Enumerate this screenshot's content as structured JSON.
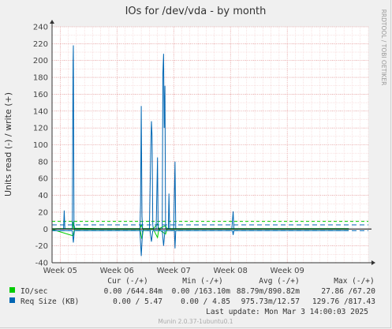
{
  "chart_data": {
    "type": "line",
    "title": "IOs for /dev/vda - by month",
    "ylabel": "Units read (-) / write (+)",
    "side_label": "RRDTOOL / TOBI OETIKER",
    "ylim": [
      -40,
      240
    ],
    "yticks": [
      -40,
      -20,
      0,
      20,
      40,
      60,
      80,
      100,
      120,
      140,
      160,
      180,
      200,
      220,
      240
    ],
    "xlim": [
      "2025-01-26",
      "2025-03-06"
    ],
    "xticks": [
      {
        "x": "2025-01-27",
        "label": "Week 05"
      },
      {
        "x": "2025-02-03",
        "label": "Week 06"
      },
      {
        "x": "2025-02-10",
        "label": "Week 07"
      },
      {
        "x": "2025-02-17",
        "label": "Week 08"
      },
      {
        "x": "2025-02-24",
        "label": "Week 09"
      }
    ],
    "grid": true,
    "series": [
      {
        "name": "IO/sec",
        "color": "#00cc00",
        "points": [
          [
            "2025-01-26T00:00",
            0.4
          ],
          [
            "2025-01-27T00:00",
            0.5
          ],
          [
            "2025-01-28T12:00",
            0.6
          ],
          [
            "2025-01-28T14:00",
            9
          ],
          [
            "2025-01-28T16:00",
            1
          ],
          [
            "2025-02-01T00:00",
            0.5
          ],
          [
            "2025-02-05T20:00",
            0.5
          ],
          [
            "2025-02-06T00:00",
            5
          ],
          [
            "2025-02-06T04:00",
            0.6
          ],
          [
            "2025-02-07T12:00",
            0.5
          ],
          [
            "2025-02-08T00:00",
            6
          ],
          [
            "2025-02-08T04:00",
            0.5
          ],
          [
            "2025-02-09T00:00",
            4
          ],
          [
            "2025-02-09T04:00",
            0.5
          ],
          [
            "2025-02-16T00:00",
            0.5
          ],
          [
            "2025-03-03T14:00",
            0.5
          ]
        ],
        "neg_points": [
          [
            "2025-01-26T00:00",
            0.3
          ],
          [
            "2025-01-28T14:00",
            8
          ],
          [
            "2025-01-28T18:00",
            0.4
          ],
          [
            "2025-02-05T20:00",
            0.4
          ],
          [
            "2025-02-06T02:00",
            12
          ],
          [
            "2025-02-06T06:00",
            0.4
          ],
          [
            "2025-02-07T12:00",
            0.4
          ],
          [
            "2025-02-08T00:00",
            10
          ],
          [
            "2025-02-08T04:00",
            0.4
          ],
          [
            "2025-02-09T00:00",
            6
          ],
          [
            "2025-02-09T04:00",
            0.4
          ],
          [
            "2025-03-03T14:00",
            0.3
          ]
        ],
        "max_line": 9
      },
      {
        "name": "Req Size (KB)",
        "color": "#0066b3",
        "points": [
          [
            "2025-01-26T00:00",
            0
          ],
          [
            "2025-01-27T10:00",
            0
          ],
          [
            "2025-01-27T12:00",
            22
          ],
          [
            "2025-01-27T14:00",
            0
          ],
          [
            "2025-01-28T12:00",
            0
          ],
          [
            "2025-01-28T14:00",
            195
          ],
          [
            "2025-01-28T15:00",
            218
          ],
          [
            "2025-01-28T17:00",
            5
          ],
          [
            "2025-01-28T20:00",
            0
          ],
          [
            "2025-02-05T20:00",
            0
          ],
          [
            "2025-02-05T22:00",
            30
          ],
          [
            "2025-02-06T00:00",
            146
          ],
          [
            "2025-02-06T02:00",
            15
          ],
          [
            "2025-02-06T04:00",
            0
          ],
          [
            "2025-02-07T00:00",
            0
          ],
          [
            "2025-02-07T04:00",
            92
          ],
          [
            "2025-02-07T06:00",
            128
          ],
          [
            "2025-02-07T08:00",
            110
          ],
          [
            "2025-02-07T10:00",
            5
          ],
          [
            "2025-02-07T12:00",
            0
          ],
          [
            "2025-02-07T20:00",
            0
          ],
          [
            "2025-02-08T00:00",
            85
          ],
          [
            "2025-02-08T02:00",
            0
          ],
          [
            "2025-02-08T14:00",
            0
          ],
          [
            "2025-02-08T16:00",
            185
          ],
          [
            "2025-02-08T18:00",
            208
          ],
          [
            "2025-02-08T20:00",
            120
          ],
          [
            "2025-02-08T22:00",
            170
          ],
          [
            "2025-02-09T00:00",
            0
          ],
          [
            "2025-02-09T08:00",
            0
          ],
          [
            "2025-02-09T10:00",
            42
          ],
          [
            "2025-02-09T12:00",
            0
          ],
          [
            "2025-02-10T00:00",
            0
          ],
          [
            "2025-02-10T04:00",
            80
          ],
          [
            "2025-02-10T06:00",
            0
          ],
          [
            "2025-02-17T04:00",
            0
          ],
          [
            "2025-02-17T08:00",
            21
          ],
          [
            "2025-02-17T10:00",
            0
          ],
          [
            "2025-03-03T14:00",
            0
          ]
        ],
        "neg_points": [
          [
            "2025-01-26T00:00",
            2
          ],
          [
            "2025-01-28T12:00",
            2
          ],
          [
            "2025-01-28T15:00",
            16
          ],
          [
            "2025-01-28T18:00",
            2
          ],
          [
            "2025-02-05T20:00",
            2
          ],
          [
            "2025-02-06T00:00",
            32
          ],
          [
            "2025-02-06T04:00",
            2
          ],
          [
            "2025-02-07T02:00",
            2
          ],
          [
            "2025-02-07T06:00",
            15
          ],
          [
            "2025-02-07T10:00",
            2
          ],
          [
            "2025-02-08T14:00",
            2
          ],
          [
            "2025-02-08T18:00",
            20
          ],
          [
            "2025-02-08T22:00",
            2
          ],
          [
            "2025-02-10T02:00",
            2
          ],
          [
            "2025-02-10T04:00",
            23
          ],
          [
            "2025-02-10T06:00",
            2
          ],
          [
            "2025-02-17T06:00",
            2
          ],
          [
            "2025-02-17T08:00",
            7
          ],
          [
            "2025-02-17T10:00",
            2
          ],
          [
            "2025-03-03T14:00",
            2
          ]
        ],
        "max_line": 5,
        "neg_max_line": 2
      }
    ]
  },
  "legend": {
    "headers": [
      "Cur (-/+)",
      "Min (-/+)",
      "Avg (-/+)",
      "Max (-/+)"
    ],
    "rows": [
      {
        "name": "IO/sec",
        "color": "#00cc00",
        "cur": "0.00 /644.84m",
        "min": "0.00 /163.10m",
        "avg": "88.79m/890.82m",
        "max": "27.86 /67.20"
      },
      {
        "name": "Req Size (KB)",
        "color": "#0066b3",
        "cur": "0.00 / 5.47",
        "min": "0.00 / 4.85",
        "avg": "975.73m/12.57",
        "max": "129.76 /817.43"
      }
    ],
    "last_update": "Last update: Mon Mar  3 14:00:03 2025"
  },
  "footer": "Munin 2.0.37-1ubuntu0.1"
}
